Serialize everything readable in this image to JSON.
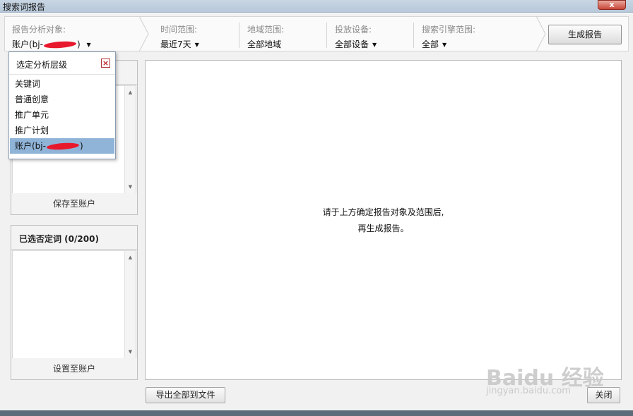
{
  "window": {
    "title": "搜索词报告",
    "close_symbol": "x"
  },
  "filters": [
    {
      "label": "报告分析对象:",
      "value_prefix": "账户(bj-",
      "value_suffix": ")"
    },
    {
      "label": "时间范围:",
      "value": "最近7天"
    },
    {
      "label": "地域范围:",
      "value": "全部地域"
    },
    {
      "label": "投放设备:",
      "value": "全部设备"
    },
    {
      "label": "搜索引擎范围:",
      "value": "全部"
    }
  ],
  "generate_button": "生成报告",
  "level_popup": {
    "title": "选定分析层级",
    "close_icon": "close-red-x",
    "items": [
      "关键词",
      "普通创意",
      "推广单元",
      "推广计划"
    ],
    "selected_item_prefix": "账户(bj-",
    "selected_item_suffix": ")"
  },
  "left_panel_top": {
    "footer": "保存至账户"
  },
  "left_panel_bottom": {
    "title": "已选否定词 (0/200)",
    "footer": "设置至账户"
  },
  "main": {
    "message_line1": "请于上方确定报告对象及范围后,",
    "message_line2": "再生成报告。"
  },
  "export_button": "导出全部到文件",
  "close_button": "关闭",
  "watermark": {
    "brand": "Baidu 经验",
    "url": "jingyan.baidu.com"
  },
  "colors": {
    "selected_row": "#8fb4d8",
    "redaction": "#e8192c",
    "close_red": "#c9473a"
  }
}
